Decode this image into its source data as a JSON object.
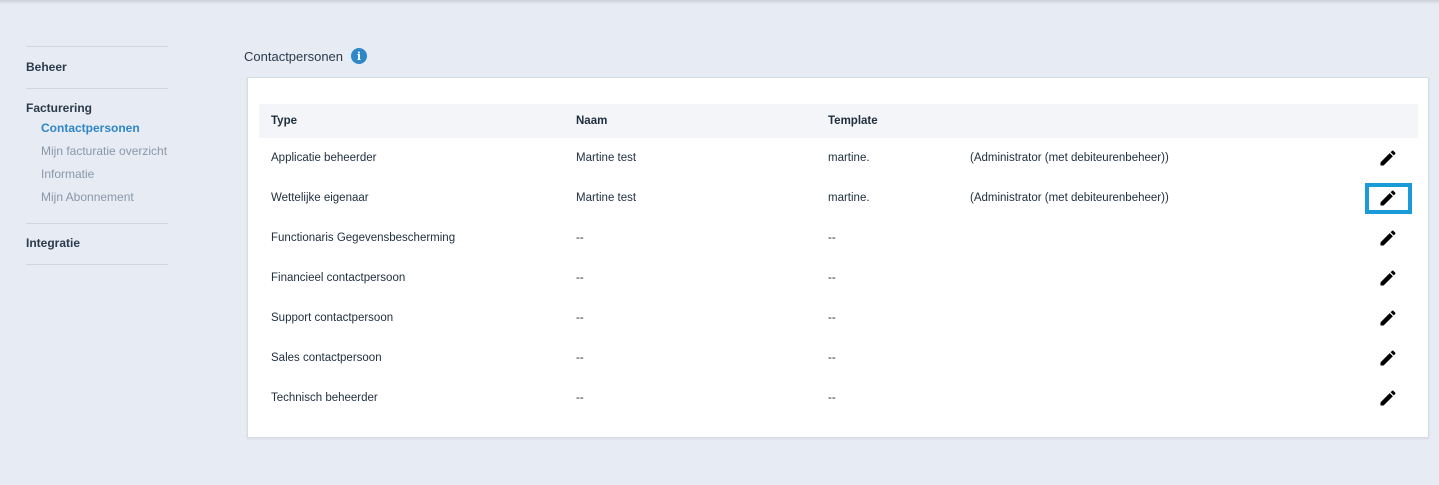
{
  "sidebar": {
    "groups": [
      {
        "label": "Beheer",
        "items": []
      },
      {
        "label": "Facturering",
        "items": [
          {
            "label": "Contactpersonen",
            "active": true
          },
          {
            "label": "Mijn facturatie overzicht",
            "active": false
          },
          {
            "label": "Informatie",
            "active": false
          },
          {
            "label": "Mijn Abonnement",
            "active": false
          }
        ]
      },
      {
        "label": "Integratie",
        "items": []
      }
    ]
  },
  "main": {
    "title": "Contactpersonen",
    "info_icon": "i",
    "table": {
      "headers": {
        "type": "Type",
        "naam": "Naam",
        "template": "Template"
      },
      "rows": [
        {
          "type": "Applicatie beheerder",
          "naam": "Martine test",
          "template": "martine.",
          "role": "(Administrator (met debiteurenbeheer))"
        },
        {
          "type": "Wettelijke eigenaar",
          "naam": "Martine test",
          "template": "martine.",
          "role": "(Administrator (met debiteurenbeheer))"
        },
        {
          "type": "Functionaris Gegevensbescherming",
          "naam": "--",
          "template": "--",
          "role": ""
        },
        {
          "type": "Financieel contactpersoon",
          "naam": "--",
          "template": "--",
          "role": ""
        },
        {
          "type": "Support contactpersoon",
          "naam": "--",
          "template": "--",
          "role": ""
        },
        {
          "type": "Sales contactpersoon",
          "naam": "--",
          "template": "--",
          "role": ""
        },
        {
          "type": "Technisch beheerder",
          "naam": "--",
          "template": "--",
          "role": ""
        }
      ]
    }
  },
  "colors": {
    "accent": "#2f86c8",
    "focus": "#1a9ad6",
    "background": "#e7ecf4"
  },
  "icons": {
    "edit": "pencil-icon",
    "info": "info-icon"
  }
}
